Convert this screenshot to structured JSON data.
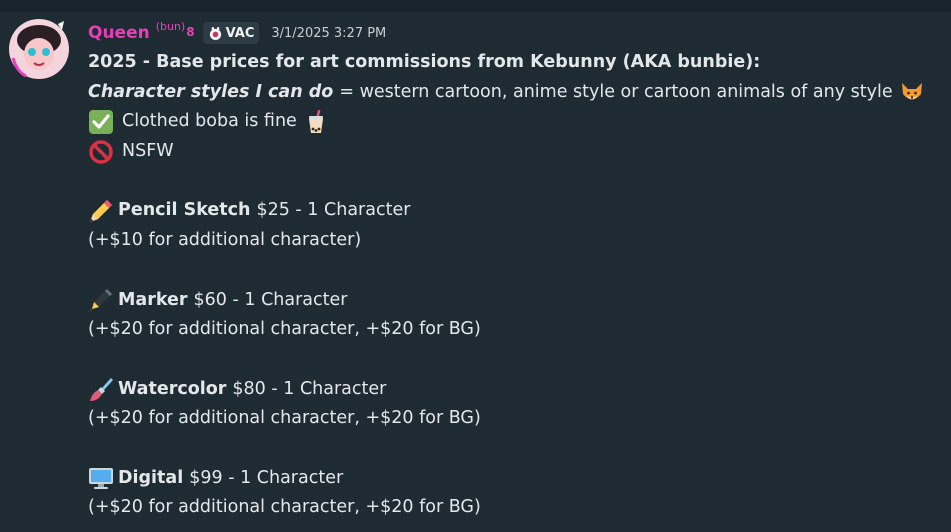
{
  "message": {
    "author": "Queen",
    "author_tag": "(bun)",
    "author_tag_glyph": "8",
    "guild_tag": "VAC",
    "timestamp": "3/1/2025 3:27 PM",
    "heading": "2025 - Base prices for art commissions from Kebunny (AKA bunbie):",
    "styles_label": "Character styles I can do",
    "styles_text": "= western cartoon, anime style or cartoon animals of any style",
    "boba_text": "Clothed boba is fine",
    "nsfw_text": "NSFW",
    "items": [
      {
        "name": "Pencil Sketch",
        "price": "$25 -  1 Character",
        "note": "(+$10 for additional character)",
        "icon": "pencil-icon"
      },
      {
        "name": "Marker",
        "price": "$60 - 1 Character",
        "note": "(+$20 for additional character, +$20 for BG)",
        "icon": "marker-icon"
      },
      {
        "name": "Watercolor",
        "price": "$80  - 1 Character",
        "note": "(+$20 for additional character, +$20 for BG)",
        "icon": "paintbrush-icon"
      },
      {
        "name": "Digital",
        "price": "$99 - 1 Character",
        "note": "(+$20 for additional character, +$20 for BG)",
        "icon": "computer-icon"
      }
    ]
  },
  "colors": {
    "background": "#1e2b33",
    "author": "#e83fb8",
    "text": "#e4e7ea",
    "timestamp": "#c9cdd2"
  }
}
